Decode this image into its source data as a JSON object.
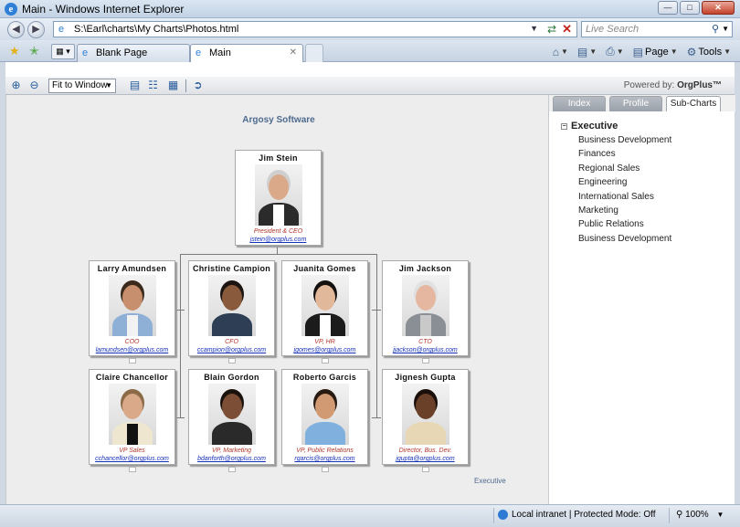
{
  "window": {
    "title": "Main - Windows Internet Explorer",
    "address": "S:\\Earl\\charts\\My Charts\\Photos.html",
    "search_placeholder": "Live Search",
    "tabs": [
      {
        "label": "Blank Page"
      },
      {
        "label": "Main"
      }
    ],
    "commands": {
      "page": "Page",
      "tools": "Tools"
    }
  },
  "toolbar": {
    "fit_value": "Fit to Window",
    "powered_prefix": "Powered by:",
    "powered_brand": "OrgPlus™"
  },
  "chart": {
    "company": "Argosy Software",
    "footer_link": "Executive",
    "root": {
      "name": "Jim Stein",
      "title": "President & CEO",
      "email": "jstein@orgplus.com"
    },
    "row1": [
      {
        "name": "Larry Amundsen",
        "title": "COO",
        "email": "lamundsen@orgplus.com"
      },
      {
        "name": "Christine Campion",
        "title": "CFO",
        "email": "ccampion@orgplus.com"
      },
      {
        "name": "Juanita Gomes",
        "title": "VP, HR",
        "email": "jgomes@orgplus.com"
      },
      {
        "name": "Jim Jackson",
        "title": "CTO",
        "email": "jjackson@orgplus.com"
      }
    ],
    "row2": [
      {
        "name": "Claire Chancellor",
        "title": "VP Sales",
        "email": "cchancellor@orgplus.com"
      },
      {
        "name": "Blain Gordon",
        "title": "VP, Marketing",
        "email": "bdanforth@orgplus.com"
      },
      {
        "name": "Roberto Garcis",
        "title": "VP, Public Relations",
        "email": "rgarcis@orgplus.com"
      },
      {
        "name": "Jignesh Gupta",
        "title": "Director, Bus. Dev.",
        "email": "jgupta@orgplus.com"
      }
    ]
  },
  "panel": {
    "tabs": [
      "Index",
      "Profile",
      "Sub-Charts"
    ],
    "active_tab": "Sub-Charts",
    "tree_root": "Executive",
    "tree_items": [
      "Business Development",
      "Finances",
      "Regional Sales",
      "Engineering",
      "International Sales",
      "Marketing",
      "Public Relations",
      "Business Development"
    ]
  },
  "status": {
    "zone": "Local intranet | Protected Mode: Off",
    "zoom": "100%"
  },
  "portraits": [
    {
      "skin": "#d9a98a",
      "hair": "#cfcfcf",
      "cloth": "#2b2b2b",
      "shirt": "#ffffff"
    },
    {
      "skin": "#c78f6e",
      "hair": "#3a2a1c",
      "cloth": "#8eb0d6",
      "shirt": "#f2f2f2"
    },
    {
      "skin": "#8a5a3c",
      "hair": "#1c1410",
      "cloth": "#2d3e55",
      "shirt": "#2d3e55"
    },
    {
      "skin": "#e2b89a",
      "hair": "#15110e",
      "cloth": "#1b1b1b",
      "shirt": "#ffffff"
    },
    {
      "skin": "#e5b7a0",
      "hair": "#e0e0e0",
      "cloth": "#8a8f95",
      "shirt": "#c9c9c9"
    },
    {
      "skin": "#d9a98a",
      "hair": "#8b6a48",
      "cloth": "#eee6cf",
      "shirt": "#111111"
    },
    {
      "skin": "#7b4e35",
      "hair": "#1a120c",
      "cloth": "#2a2a2a",
      "shirt": "#2a2a2a"
    },
    {
      "skin": "#d19a72",
      "hair": "#2a1b12",
      "cloth": "#7fb0de",
      "shirt": "#7fb0de"
    },
    {
      "skin": "#6b4028",
      "hair": "#1a0f0a",
      "cloth": "#e8d7b4",
      "shirt": "#e8d7b4"
    }
  ]
}
